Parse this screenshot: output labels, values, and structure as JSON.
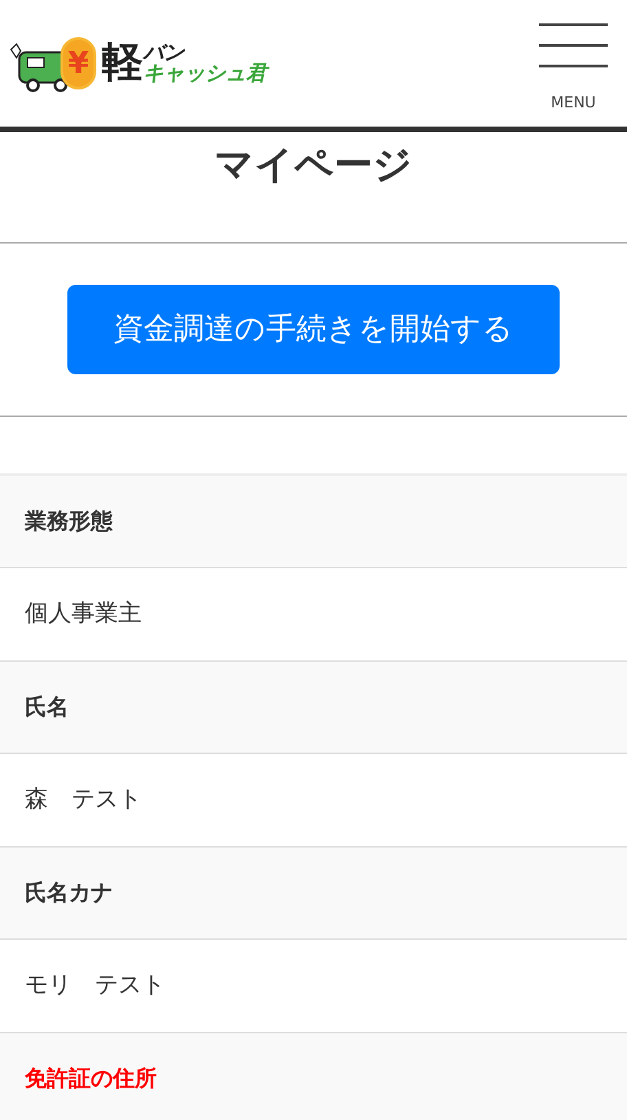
{
  "header": {
    "logo": {
      "main": "軽",
      "sub_top": "バン",
      "sub_bottom": "キャッシュ君",
      "coin": "¥"
    },
    "menu_label": "MENU"
  },
  "title": "マイページ",
  "start_button": "資金調達の手続きを開始する",
  "fields": [
    {
      "label": "業務形態",
      "value": "個人事業主",
      "highlight": false
    },
    {
      "label": "氏名",
      "value": "森　テスト",
      "highlight": false
    },
    {
      "label": "氏名カナ",
      "value": "モリ　テスト",
      "highlight": false
    },
    {
      "label": "免許証の住所",
      "highlight": true
    }
  ]
}
